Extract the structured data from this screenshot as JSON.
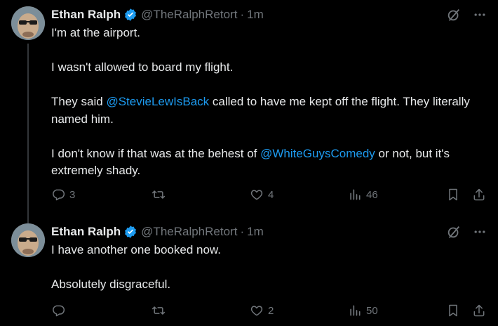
{
  "tweets": [
    {
      "author_name": "Ethan Ralph",
      "handle": "@TheRalphRetort",
      "separator": "·",
      "time": "1m",
      "text": {
        "p1": "I'm at the airport.",
        "p2": "I wasn't allowed to board my flight.",
        "p3_before": "They said ",
        "p3_mention": "@StevieLewIsBack",
        "p3_after": " called to have me kept off the flight. They literally named him.",
        "p4_before": "I don't know if that was at the behest of ",
        "p4_mention": "@WhiteGuysComedy",
        "p4_after": " or not, but it's extremely shady."
      },
      "replies": "3",
      "reposts": "",
      "likes": "4",
      "views": "46"
    },
    {
      "author_name": "Ethan Ralph",
      "handle": "@TheRalphRetort",
      "separator": "·",
      "time": "1m",
      "text": {
        "p1": "I have another one booked now.",
        "p2": "Absolutely disgraceful."
      },
      "replies": "",
      "reposts": "",
      "likes": "2",
      "views": "50"
    }
  ],
  "colors": {
    "background": "#000000",
    "text": "#e7e9ea",
    "muted": "#71767b",
    "accent": "#1d9bf0",
    "thread_line": "#333639"
  },
  "icons": [
    "verified-badge-icon",
    "grok-icon",
    "more-icon",
    "reply-icon",
    "repost-icon",
    "like-icon",
    "views-icon",
    "bookmark-icon",
    "share-icon"
  ]
}
